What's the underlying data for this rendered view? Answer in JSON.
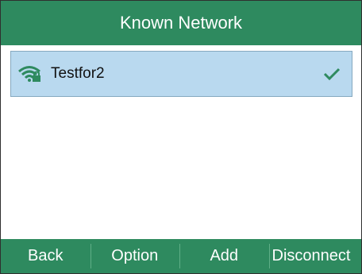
{
  "header": {
    "title": "Known Network"
  },
  "networks": [
    {
      "name": "Testfor2",
      "status": "connected",
      "icon": "wifi-locked-icon",
      "selected": true
    }
  ],
  "softkeys": {
    "back": "Back",
    "option": "Option",
    "add": "Add",
    "disconnect": "Disconnect"
  },
  "colors": {
    "header_bg": "#2e8a5f",
    "selection_bg": "#b9d9ef",
    "wifi_icon": "#2e8a5f",
    "check": "#2e8a5f"
  }
}
